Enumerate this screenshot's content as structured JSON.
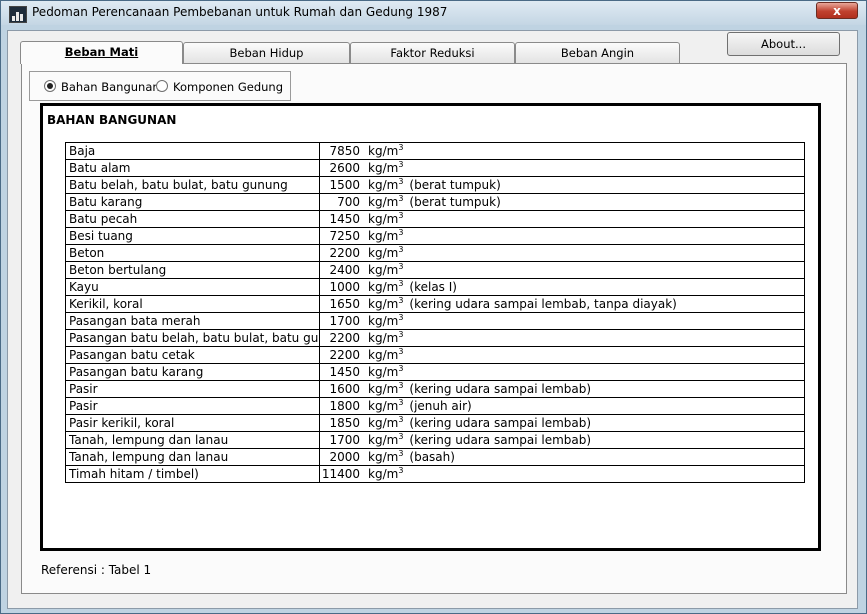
{
  "window": {
    "title": "Pedoman Perencanaan Pembebanan untuk Rumah dan Gedung 1987",
    "close_label": "x"
  },
  "tabs": [
    {
      "label": "Beban Mati",
      "active": true
    },
    {
      "label": "Beban Hidup",
      "active": false
    },
    {
      "label": "Faktor Reduksi",
      "active": false
    },
    {
      "label": "Beban Angin",
      "active": false
    }
  ],
  "about_label": "About...",
  "radios": [
    {
      "label": "Bahan Bangunan",
      "selected": true
    },
    {
      "label": "Komponen Gedung",
      "selected": false
    }
  ],
  "section_title": "BAHAN BANGUNAN",
  "unit": {
    "base": "kg/m",
    "exp": "3"
  },
  "materials": [
    {
      "name": "Baja",
      "value": "7850",
      "note": ""
    },
    {
      "name": "Batu alam",
      "value": "2600",
      "note": ""
    },
    {
      "name": "Batu belah, batu bulat, batu gunung",
      "value": "1500",
      "note": "(berat tumpuk)"
    },
    {
      "name": "Batu karang",
      "value": "700",
      "note": "(berat tumpuk)"
    },
    {
      "name": "Batu pecah",
      "value": "1450",
      "note": ""
    },
    {
      "name": "Besi tuang",
      "value": "7250",
      "note": ""
    },
    {
      "name": "Beton",
      "value": "2200",
      "note": ""
    },
    {
      "name": "Beton bertulang",
      "value": "2400",
      "note": ""
    },
    {
      "name": "Kayu",
      "value": "1000",
      "note": "(kelas I)"
    },
    {
      "name": "Kerikil, koral",
      "value": "1650",
      "note": "(kering udara sampai lembab, tanpa diayak)"
    },
    {
      "name": "Pasangan bata merah",
      "value": "1700",
      "note": ""
    },
    {
      "name": "Pasangan batu belah, batu bulat, batu gunur",
      "value": "2200",
      "note": ""
    },
    {
      "name": "Pasangan batu cetak",
      "value": "2200",
      "note": ""
    },
    {
      "name": "Pasangan batu karang",
      "value": "1450",
      "note": ""
    },
    {
      "name": "Pasir",
      "value": "1600",
      "note": "(kering udara sampai lembab)"
    },
    {
      "name": "Pasir",
      "value": "1800",
      "note": "(jenuh air)"
    },
    {
      "name": "Pasir kerikil, koral",
      "value": "1850",
      "note": "(kering udara sampai lembab)"
    },
    {
      "name": "Tanah, lempung dan lanau",
      "value": "1700",
      "note": "(kering udara sampai lembab)"
    },
    {
      "name": "Tanah, lempung dan lanau",
      "value": "2000",
      "note": "(basah)"
    },
    {
      "name": "Timah hitam / timbel)",
      "value": "11400",
      "note": ""
    }
  ],
  "reference": "Referensi : Tabel 1"
}
